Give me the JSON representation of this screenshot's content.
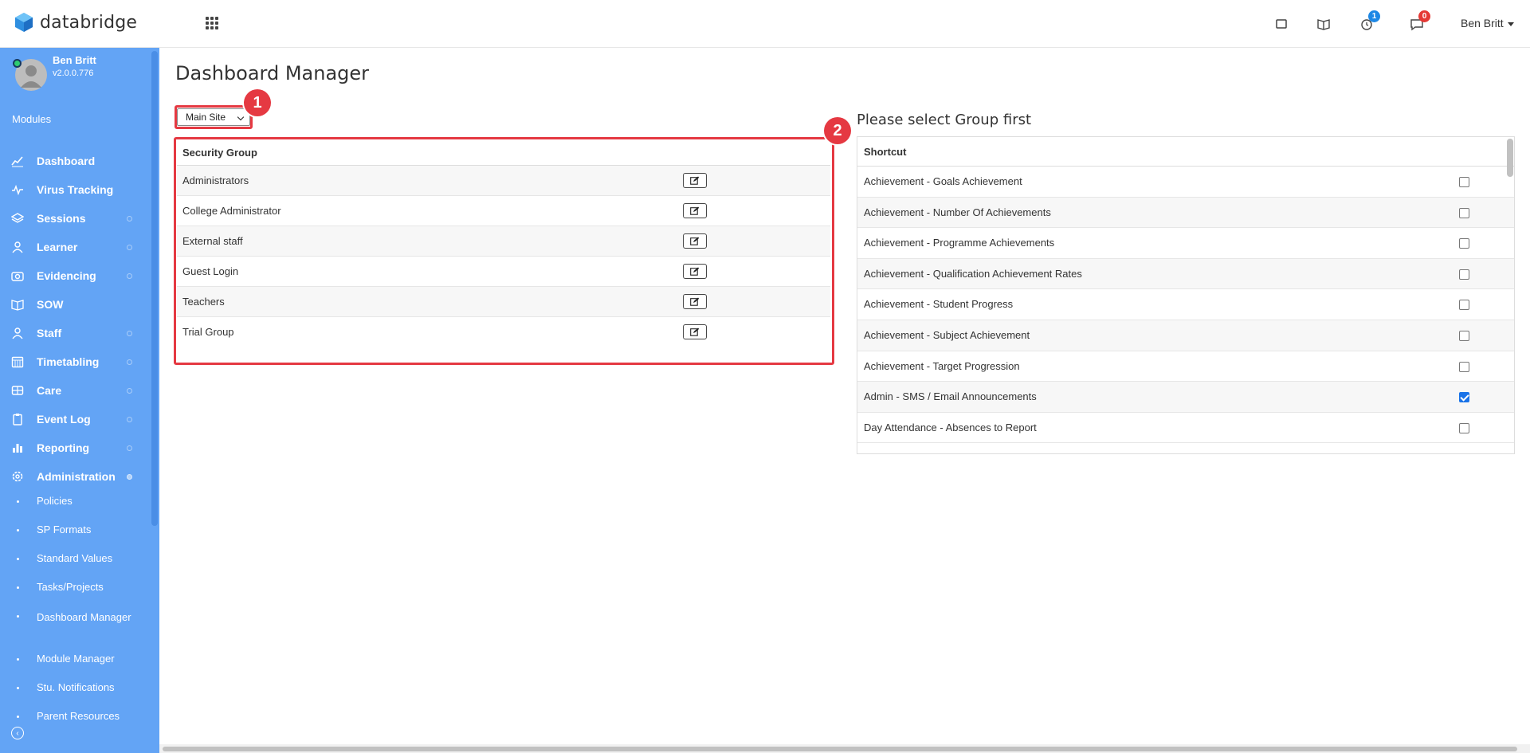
{
  "brand": {
    "name": "databridge",
    "accent": "#63a4f5"
  },
  "header": {
    "badge_tasks": "1",
    "badge_messages": "0",
    "user_name": "Ben Britt"
  },
  "profile": {
    "name": "Ben Britt",
    "version": "v2.0.0.776"
  },
  "sidebar": {
    "modules_label": "Modules",
    "items": [
      {
        "label": "Dashboard",
        "icon": "chart-line-icon"
      },
      {
        "label": "Virus Tracking",
        "icon": "pulse-icon"
      },
      {
        "label": "Sessions",
        "icon": "layers-icon"
      },
      {
        "label": "Learner",
        "icon": "user-icon"
      },
      {
        "label": "Evidencing",
        "icon": "camera-icon"
      },
      {
        "label": "SOW",
        "icon": "book-icon"
      },
      {
        "label": "Staff",
        "icon": "user-icon"
      },
      {
        "label": "Timetabling",
        "icon": "calendar-icon"
      },
      {
        "label": "Care",
        "icon": "care-icon"
      },
      {
        "label": "Event Log",
        "icon": "clipboard-icon"
      },
      {
        "label": "Reporting",
        "icon": "bar-chart-icon"
      },
      {
        "label": "Administration",
        "icon": "gear-icon"
      }
    ],
    "subitems": [
      {
        "label": "Policies"
      },
      {
        "label": "SP Formats"
      },
      {
        "label": "Standard Values"
      },
      {
        "label": "Tasks/Projects"
      },
      {
        "label": "Dashboard Manager"
      },
      {
        "label": "Module Manager"
      },
      {
        "label": "Stu. Notifications"
      },
      {
        "label": "Parent Resources"
      }
    ]
  },
  "main": {
    "title": "Dashboard Manager",
    "site_select": {
      "value": "Main Site"
    },
    "markers": [
      "1",
      "2"
    ],
    "security_table": {
      "header": "Security Group",
      "rows": [
        "Administrators",
        "College Administrator",
        "External staff",
        "Guest Login",
        "Teachers",
        "Trial Group"
      ]
    },
    "right_panel": {
      "title": "Please select Group first",
      "header": "Shortcut",
      "rows": [
        {
          "label": "Achievement - Goals Achievement",
          "checked": false
        },
        {
          "label": "Achievement - Number Of Achievements",
          "checked": false
        },
        {
          "label": "Achievement - Programme Achievements",
          "checked": false
        },
        {
          "label": "Achievement - Qualification Achievement Rates",
          "checked": false
        },
        {
          "label": "Achievement - Student Progress",
          "checked": false
        },
        {
          "label": "Achievement - Subject Achievement",
          "checked": false
        },
        {
          "label": "Achievement - Target Progression",
          "checked": false
        },
        {
          "label": "Admin - SMS / Email Announcements",
          "checked": true
        },
        {
          "label": "Day Attendance - Absences to Report",
          "checked": false
        }
      ]
    }
  }
}
